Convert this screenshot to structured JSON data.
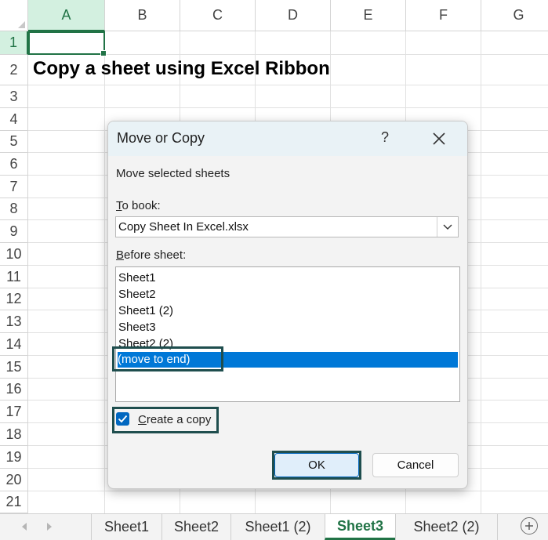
{
  "spreadsheet": {
    "columns": [
      "A",
      "B",
      "C",
      "D",
      "E",
      "F",
      "G"
    ],
    "rows": [
      "1",
      "2",
      "3",
      "4",
      "5",
      "6",
      "7",
      "8",
      "9",
      "10",
      "11",
      "12",
      "13",
      "14",
      "15",
      "16",
      "17",
      "18",
      "19",
      "20",
      "21"
    ],
    "active_cell": "A1",
    "cell_a2": "Copy a sheet using Excel Ribbon"
  },
  "dialog": {
    "title": "Move or Copy",
    "help_label": "?",
    "section_label": "Move selected sheets",
    "to_book_label_key": "T",
    "to_book_label_rest": "o book:",
    "to_book_value": "Copy Sheet In Excel.xlsx",
    "before_sheet_label_key": "B",
    "before_sheet_label_rest": "efore sheet:",
    "before_sheet_items": [
      "Sheet1",
      "Sheet2",
      "Sheet1 (2)",
      "Sheet3",
      "Sheet2 (2)",
      "(move to end)"
    ],
    "selected_item": "(move to end)",
    "create_copy_key": "C",
    "create_copy_rest": "reate a copy",
    "create_copy_checked": true,
    "ok_label": "OK",
    "cancel_label": "Cancel"
  },
  "tabs": {
    "items": [
      "Sheet1",
      "Sheet2",
      "Sheet1 (2)",
      "Sheet3",
      "Sheet2 (2)"
    ],
    "active": "Sheet3"
  },
  "colors": {
    "excel_green": "#217346",
    "selection_blue": "#0078d7",
    "highlight_box": "#1f4e4e"
  }
}
